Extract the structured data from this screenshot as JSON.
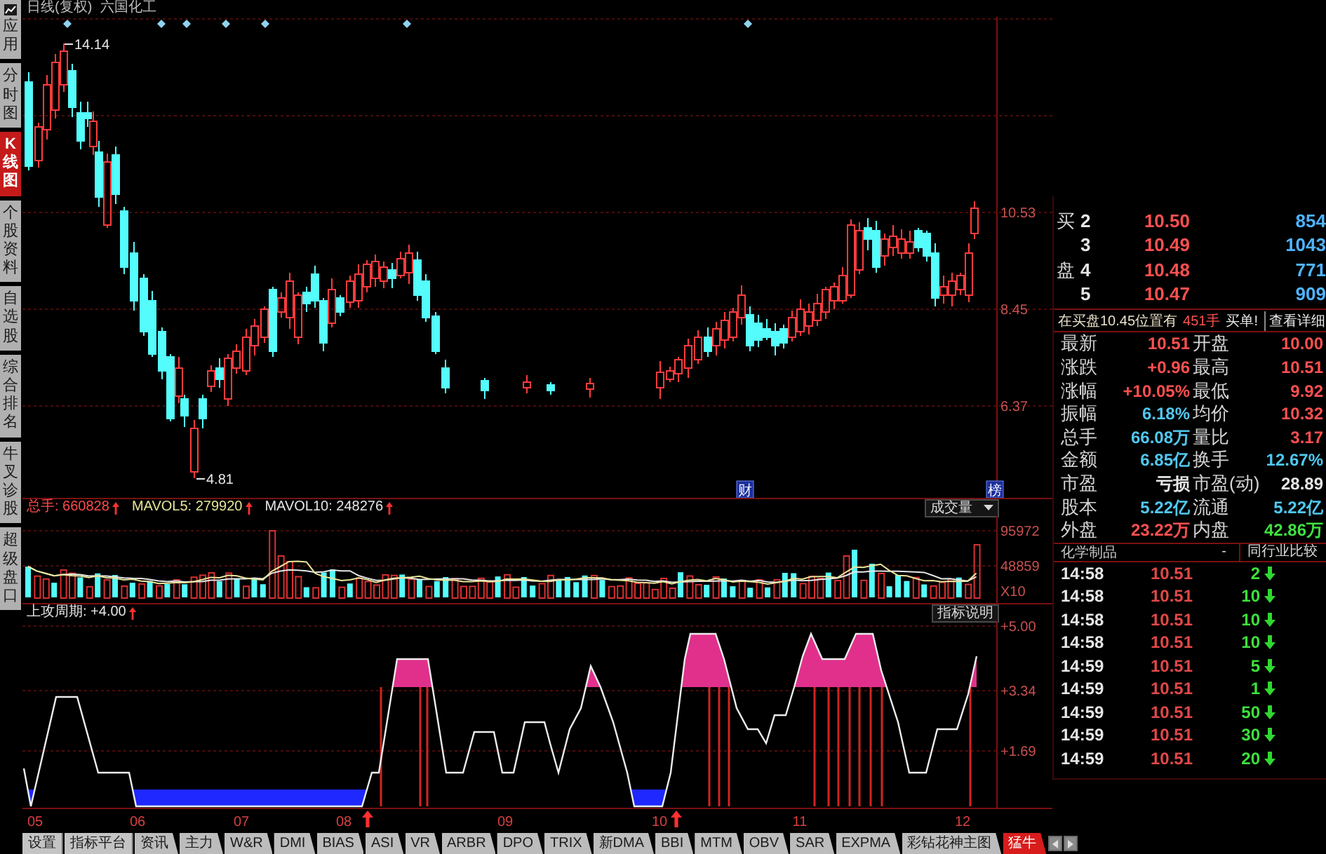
{
  "title": {
    "period": "日线(复权)",
    "stock": "六国化工"
  },
  "sidebar": [
    {
      "label": "应用",
      "selected": false
    },
    {
      "label": "分时图",
      "selected": false
    },
    {
      "label": "K线图",
      "selected": true
    },
    {
      "label": "个股资料",
      "selected": false
    },
    {
      "label": "自选股",
      "selected": false
    },
    {
      "label": "综合排名",
      "selected": false
    },
    {
      "label": "牛叉诊股",
      "selected": false
    },
    {
      "label": "超级盘口",
      "selected": false
    }
  ],
  "main_chart": {
    "high_label": "14.14",
    "low_label": "4.81",
    "price_ticks": [
      "10.53",
      "8.45",
      "6.37"
    ],
    "markers": [
      {
        "label": "财"
      },
      {
        "label": "榜"
      }
    ]
  },
  "volume_panel": {
    "indicators": [
      {
        "text": "总手: 660828",
        "color": "#ff4a4a"
      },
      {
        "text": "MAVOL5: 279920",
        "color": "#e8e49a"
      },
      {
        "text": "MAVOL10: 248276",
        "color": "#e6e6e6"
      }
    ],
    "selector": "成交量",
    "ticks": [
      "95972",
      "48859",
      "X10"
    ]
  },
  "indicator_panel": {
    "text": "上攻周期: +4.00",
    "button": "指标说明",
    "ticks": [
      "+5.00",
      "+3.34",
      "+1.69"
    ],
    "months": [
      "05",
      "06",
      "07",
      "08",
      "09",
      "10",
      "11",
      "12"
    ]
  },
  "order_book": {
    "side_label": "买盘",
    "rows": [
      {
        "level": "2",
        "price": "10.50",
        "volume": "854"
      },
      {
        "level": "3",
        "price": "10.49",
        "volume": "1043"
      },
      {
        "level": "4",
        "price": "10.48",
        "volume": "771"
      },
      {
        "level": "5",
        "price": "10.47",
        "volume": "909"
      }
    ]
  },
  "order_notice": {
    "text": "在买盘10.45位置有",
    "volume": "451手",
    "suffix": "买单!",
    "link": "查看详细"
  },
  "stats": [
    {
      "label": "最新",
      "value": "10.51",
      "color": "#ff5050"
    },
    {
      "label": "开盘",
      "value": "10.00",
      "color": "#ff5050"
    },
    {
      "label": "涨跌",
      "value": "+0.96",
      "color": "#ff5050"
    },
    {
      "label": "最高",
      "value": "10.51",
      "color": "#ff5050"
    },
    {
      "label": "涨幅",
      "value": "+10.05%",
      "color": "#ff5050"
    },
    {
      "label": "最低",
      "value": "9.92",
      "color": "#ff5050"
    },
    {
      "label": "振幅",
      "value": "6.18%",
      "color": "#50c8f0"
    },
    {
      "label": "均价",
      "value": "10.32",
      "color": "#ff5050"
    },
    {
      "label": "总手",
      "value": "66.08万",
      "color": "#50c8f0"
    },
    {
      "label": "量比",
      "value": "3.17",
      "color": "#ff5050"
    },
    {
      "label": "金额",
      "value": "6.85亿",
      "color": "#50c8f0"
    },
    {
      "label": "换手",
      "value": "12.67%",
      "color": "#50c8f0"
    },
    {
      "label": "市盈",
      "value": "亏损",
      "color": "#e6e6e6"
    },
    {
      "label": "市盈(动)",
      "value": "28.89",
      "color": "#e6e6e6"
    },
    {
      "label": "股本",
      "value": "5.22亿",
      "color": "#50c8f0"
    },
    {
      "label": "流通",
      "value": "5.22亿",
      "color": "#50c8f0"
    },
    {
      "label": "外盘",
      "value": "23.22万",
      "color": "#ff5050"
    },
    {
      "label": "内盘",
      "value": "42.86万",
      "color": "#40e040"
    }
  ],
  "trades": {
    "industry": "化学制品",
    "separator": "-",
    "compare_button": "同行业比较",
    "rows": [
      {
        "time": "14:58",
        "price": "10.51",
        "volume": "2",
        "down": true
      },
      {
        "time": "14:58",
        "price": "10.51",
        "volume": "10",
        "down": true
      },
      {
        "time": "14:58",
        "price": "10.51",
        "volume": "10",
        "down": true
      },
      {
        "time": "14:58",
        "price": "10.51",
        "volume": "10",
        "down": true
      },
      {
        "time": "14:59",
        "price": "10.51",
        "volume": "5",
        "down": true
      },
      {
        "time": "14:59",
        "price": "10.51",
        "volume": "1",
        "down": true
      },
      {
        "time": "14:59",
        "price": "10.51",
        "volume": "50",
        "down": true
      },
      {
        "time": "14:59",
        "price": "10.51",
        "volume": "30",
        "down": true
      },
      {
        "time": "14:59",
        "price": "10.51",
        "volume": "20",
        "down": true
      }
    ]
  },
  "bottom_bar": {
    "buttons": [
      "设置",
      "指标平台"
    ],
    "tabs": [
      {
        "label": "资讯",
        "selected": false
      },
      {
        "label": "主力",
        "selected": false
      },
      {
        "label": "W&R",
        "selected": false
      },
      {
        "label": "DMI",
        "selected": false
      },
      {
        "label": "BIAS",
        "selected": false
      },
      {
        "label": "ASI",
        "selected": false
      },
      {
        "label": "VR",
        "selected": false
      },
      {
        "label": "ARBR",
        "selected": false
      },
      {
        "label": "DPO",
        "selected": false
      },
      {
        "label": "TRIX",
        "selected": false
      },
      {
        "label": "新DMA",
        "selected": false
      },
      {
        "label": "BBI",
        "selected": false
      },
      {
        "label": "MTM",
        "selected": false
      },
      {
        "label": "OBV",
        "selected": false
      },
      {
        "label": "SAR",
        "selected": false
      },
      {
        "label": "EXPMA",
        "selected": false
      },
      {
        "label": "彩钻花神主图",
        "selected": false
      },
      {
        "label": "猛牛",
        "selected": true
      }
    ]
  }
}
